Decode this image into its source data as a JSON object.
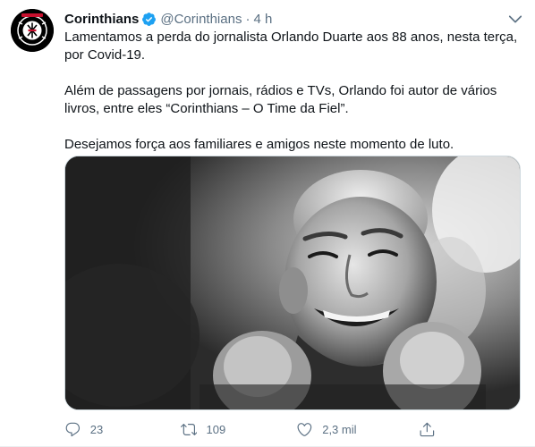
{
  "tweet": {
    "author_name": "Corinthians",
    "author_handle": "@Corinthians",
    "separator": "·",
    "timestamp": "4 h",
    "paragraphs": [
      "Lamentamos a perda do jornalista Orlando Duarte aos 88 anos, nesta terça, por Covid-19.",
      "Além de passagens por jornais, rádios e TVs, Orlando foi autor de vários livros, entre eles “Corinthians – O Time da Fiel”.",
      "Desejamos força aos familiares e amigos neste momento de luto."
    ],
    "actions": {
      "replies": "23",
      "retweets": "109",
      "likes": "2,3 mil"
    }
  },
  "colors": {
    "text": "#0f1419",
    "secondary": "#5b7083",
    "verified": "#1da1f2",
    "border": "#cfd9de"
  },
  "icons": {
    "verified": "verified-badge-icon",
    "more": "chevron-down-icon",
    "reply": "reply-icon",
    "retweet": "retweet-icon",
    "like": "heart-icon",
    "share": "share-icon"
  }
}
